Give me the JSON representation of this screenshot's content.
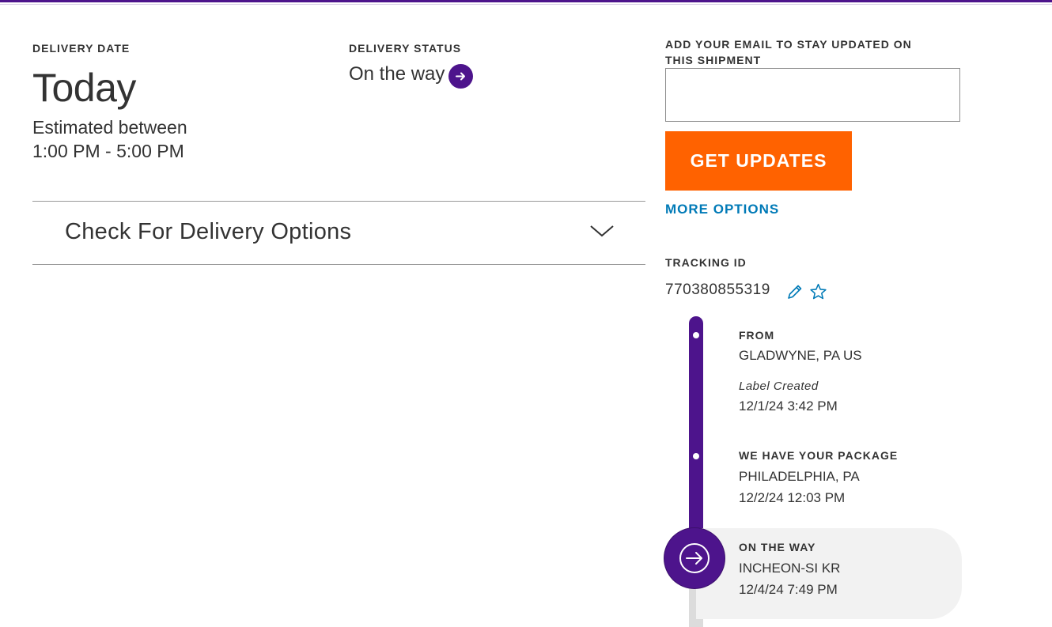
{
  "colors": {
    "brand_purple": "#4d148c",
    "cta_orange": "#ff6200",
    "link_blue": "#007ab7"
  },
  "delivery": {
    "date_label": "DELIVERY DATE",
    "date_value": "Today",
    "estimate_line1": "Estimated between",
    "estimate_line2": "1:00 PM - 5:00 PM",
    "status_label": "DELIVERY STATUS",
    "status_value": "On the way",
    "status_icon": "arrow-right-circle-icon"
  },
  "accordion": {
    "title": "Check For Delivery Options",
    "icon": "chevron-down-icon"
  },
  "email_signup": {
    "label_line1": "ADD YOUR EMAIL TO STAY UPDATED ON",
    "label_line2": "THIS SHIPMENT",
    "input_value": "",
    "button_label": "GET UPDATES",
    "more_options": "MORE OPTIONS"
  },
  "tracking": {
    "label": "TRACKING ID",
    "number": "770380855319",
    "edit_icon": "pencil-icon",
    "favorite_icon": "star-outline-icon"
  },
  "timeline": [
    {
      "title": "FROM",
      "location": "GLADWYNE, PA US",
      "note": "Label Created",
      "datetime": "12/1/24 3:42 PM"
    },
    {
      "title": "WE HAVE YOUR PACKAGE",
      "location": "PHILADELPHIA, PA",
      "datetime": "12/2/24 12:03 PM"
    },
    {
      "title": "ON THE WAY",
      "location": "INCHEON-SI KR",
      "datetime": "12/4/24 7:49 PM",
      "current": true
    }
  ]
}
